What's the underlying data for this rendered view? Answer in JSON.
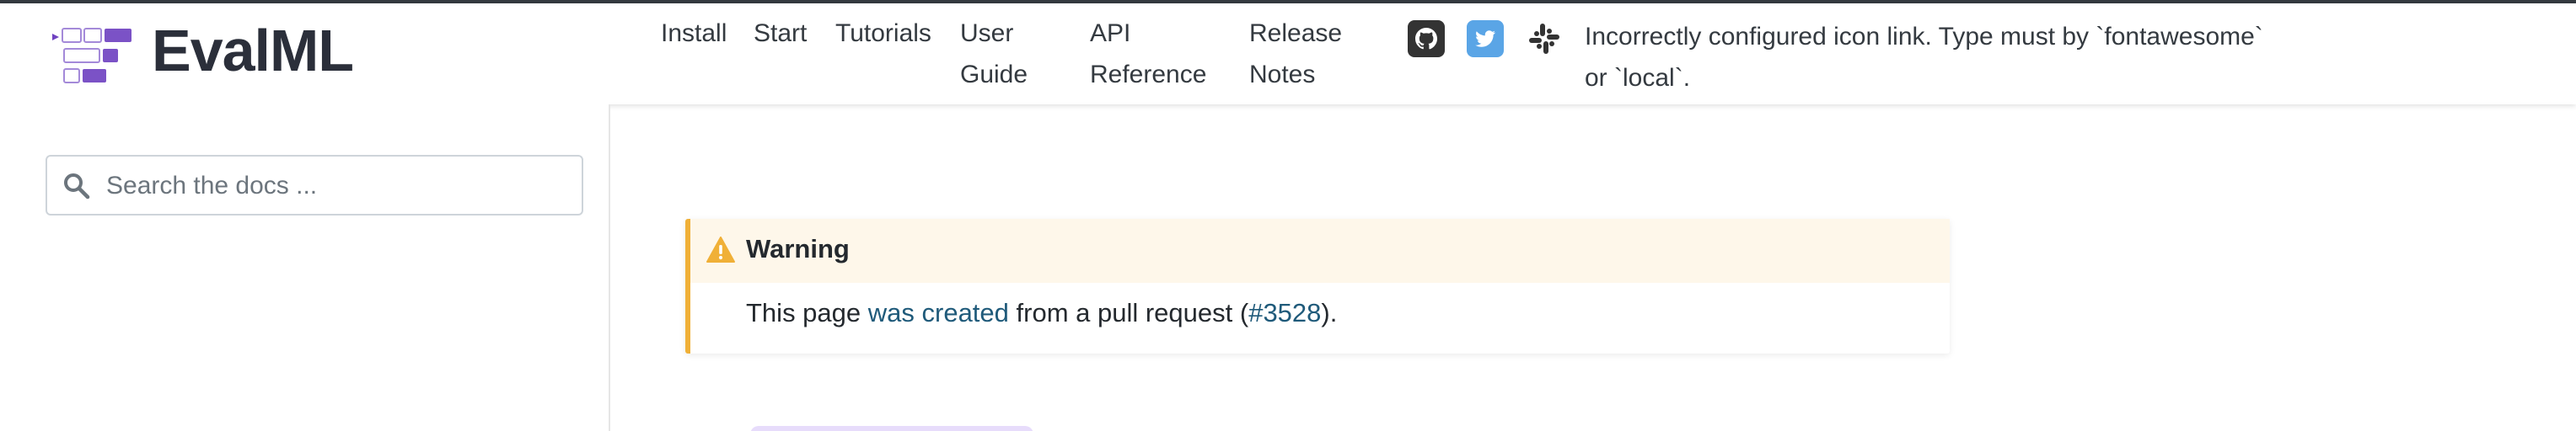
{
  "brand": {
    "name": "EvalML",
    "logo_icon": "evalml-logo-icon",
    "accent": "#7b52c6"
  },
  "nav": {
    "links": [
      {
        "label": "Install"
      },
      {
        "label": "Start"
      },
      {
        "label": "Tutorials"
      },
      {
        "line1": "User",
        "line2": "Guide"
      },
      {
        "line1": "API",
        "line2": "Reference"
      },
      {
        "line1": "Release",
        "line2": "Notes"
      }
    ],
    "icons": [
      "github-icon",
      "twitter-icon",
      "slack-icon"
    ],
    "icon_error": {
      "line1": "Incorrectly configured icon link. Type must by `fontawesome`",
      "line2": "or `local`."
    }
  },
  "sidebar": {
    "search": {
      "placeholder": "Search the docs ..."
    }
  },
  "admonition": {
    "title": "Warning",
    "body_prefix": "This page ",
    "link1": "was created",
    "body_middle": " from a pull request (",
    "link2": "#3528",
    "body_suffix": ")."
  },
  "colors": {
    "warning_border": "#f0b037",
    "warning_bg": "#fef7ea",
    "link": "#1f5a7a",
    "twitter": "#5aa5e6"
  }
}
